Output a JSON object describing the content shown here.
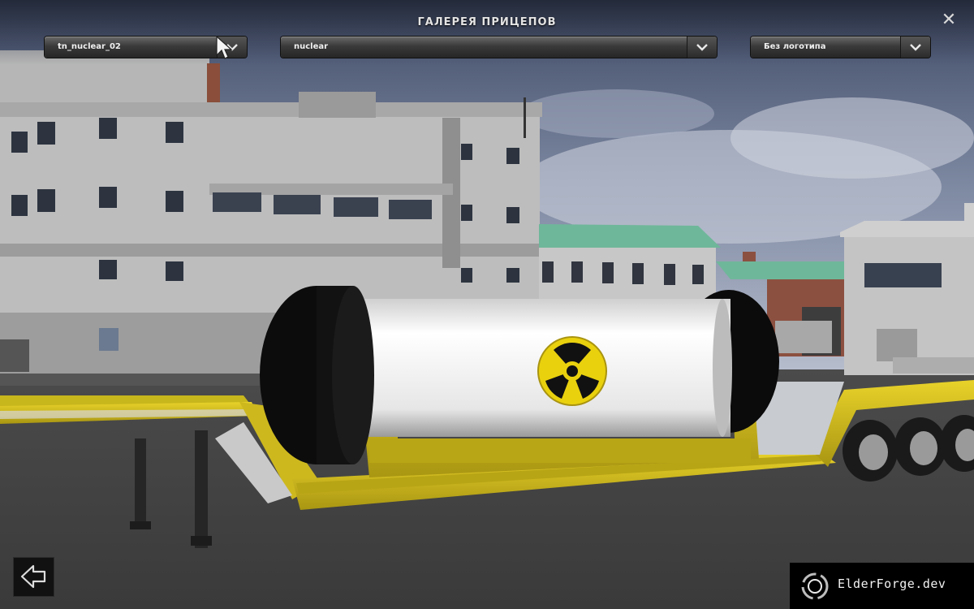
{
  "header": {
    "title": "ГАЛЕРЕЯ ПРИЦЕПОВ",
    "close_label": "✕"
  },
  "selectors": {
    "trailer": "tn_nuclear_02",
    "cargo": "nuclear",
    "logo": "Без логотипа"
  },
  "footer": {
    "back_icon": "arrow-left-icon"
  },
  "watermark": {
    "text": "ElderForge.dev"
  },
  "colors": {
    "trailer_yellow": "#d8c21a",
    "tank_white": "#f4f4f4",
    "sign_yellow": "#e9d10e"
  }
}
